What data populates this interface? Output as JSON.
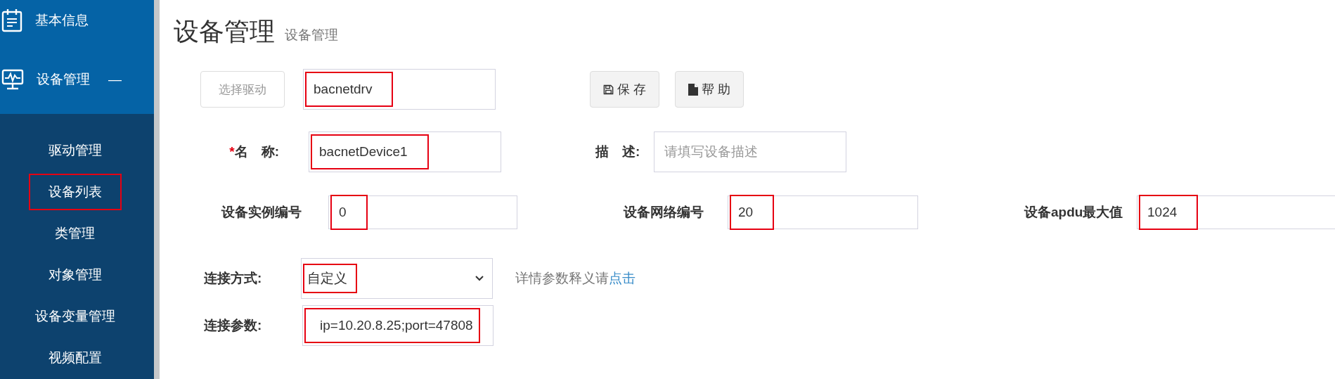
{
  "sidebar": {
    "groups": [
      {
        "label": "基本信息",
        "kind": "clipboard"
      },
      {
        "label": "设备管理",
        "kind": "monitor",
        "expanded": true,
        "toggle": "—"
      }
    ],
    "items": [
      {
        "label": "驱动管理",
        "highlighted": false
      },
      {
        "label": "设备列表",
        "highlighted": true
      },
      {
        "label": "类管理",
        "highlighted": false
      },
      {
        "label": "对象管理",
        "highlighted": false
      },
      {
        "label": "设备变量管理",
        "highlighted": false
      },
      {
        "label": "视频配置",
        "highlighted": false
      }
    ]
  },
  "page": {
    "title": "设备管理",
    "subtitle": "设备管理"
  },
  "toolbar": {
    "driver_button": {
      "label": "选择驱动",
      "disabled": true
    },
    "driver": {
      "value": "bacnetdrv",
      "highlighted": true
    },
    "buttons": [
      {
        "label": "保 存",
        "kind": "save"
      },
      {
        "label": "帮 助",
        "kind": "file"
      }
    ]
  },
  "name_row": {
    "required_mark": "*",
    "name_label": "名　称:",
    "name": {
      "value": "bacnetDevice1",
      "highlighted": true
    },
    "description_label": "描　述:",
    "description": {
      "placeholder": "请填写设备描述",
      "highlighted": false
    }
  },
  "numbers": [
    {
      "label": "设备实例编号",
      "value": "0",
      "highlighted": true
    },
    {
      "label": "设备网络编号",
      "value": "20",
      "highlighted": true
    },
    {
      "label": "设备apdu最大值",
      "value": "1024",
      "highlighted": true
    }
  ],
  "connection": {
    "mode_label": "连接方式:",
    "mode": {
      "value": "自定义",
      "highlighted": true
    },
    "hint": "详情参数释义请",
    "hint_link": "点击",
    "params_label": "连接参数:",
    "params": {
      "value": "ip=10.20.8.25;port=47808",
      "highlighted": true
    }
  }
}
